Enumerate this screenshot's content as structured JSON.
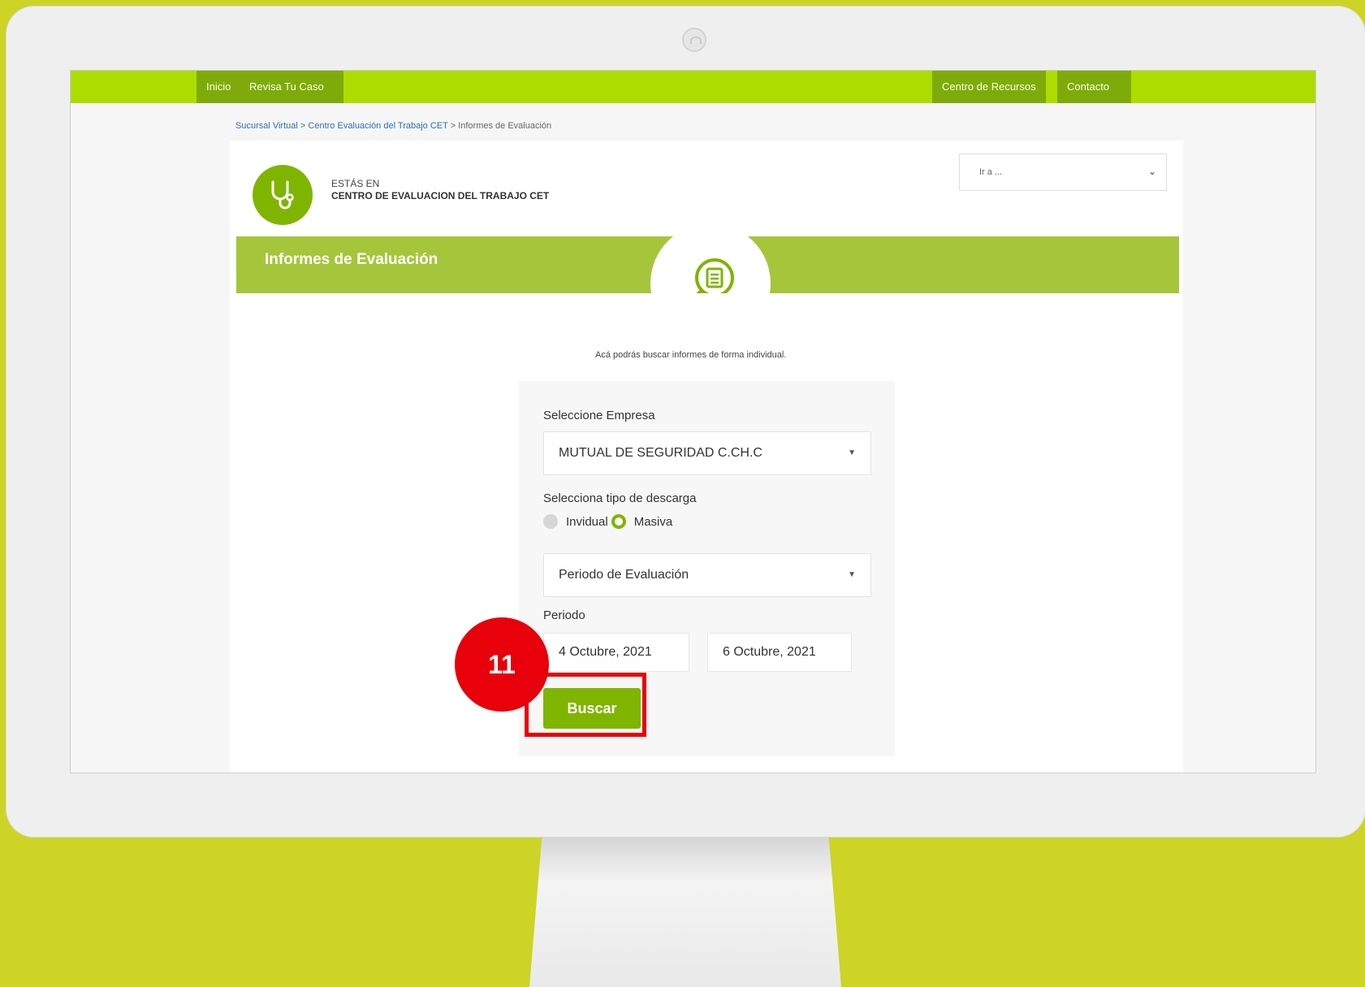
{
  "nav": {
    "left": [
      "Inicio",
      "Revisa Tu Caso"
    ],
    "right": [
      "Centro de Recursos",
      "Contacto"
    ]
  },
  "breadcrumb": {
    "items": [
      "Sucursal Virtual",
      "Centro Evaluación del Trabajo CET",
      "Informes de Evaluación"
    ],
    "sep": ">"
  },
  "header": {
    "estas_label": "ESTÁS EN",
    "section": "CENTRO DE EVALUACION DEL TRABAJO CET",
    "ira_placeholder": "Ir a ..."
  },
  "banner": {
    "title": "Informes de Evaluación"
  },
  "intro": "Acá podrás buscar informes de forma individual.",
  "form": {
    "empresa_label": "Seleccione Empresa",
    "empresa_value": "MUTUAL DE SEGURIDAD C.CH.C",
    "tipo_label": "Selecciona tipo de descarga",
    "radio_individual": "Invidual",
    "radio_masiva": "Masiva",
    "selected_radio": "Masiva",
    "periodo_select": "Periodo de Evaluación",
    "periodo_label": "Periodo",
    "fecha_desde": "4 Octubre, 2021",
    "fecha_hasta": "6 Octubre, 2021",
    "buscar": "Buscar"
  },
  "annotation": {
    "step": "11"
  },
  "colors": {
    "accent": "#7fb500",
    "nav": "#acdc00",
    "banner": "#a5c63a",
    "highlight": "#e8000a",
    "background": "#cdd425"
  }
}
